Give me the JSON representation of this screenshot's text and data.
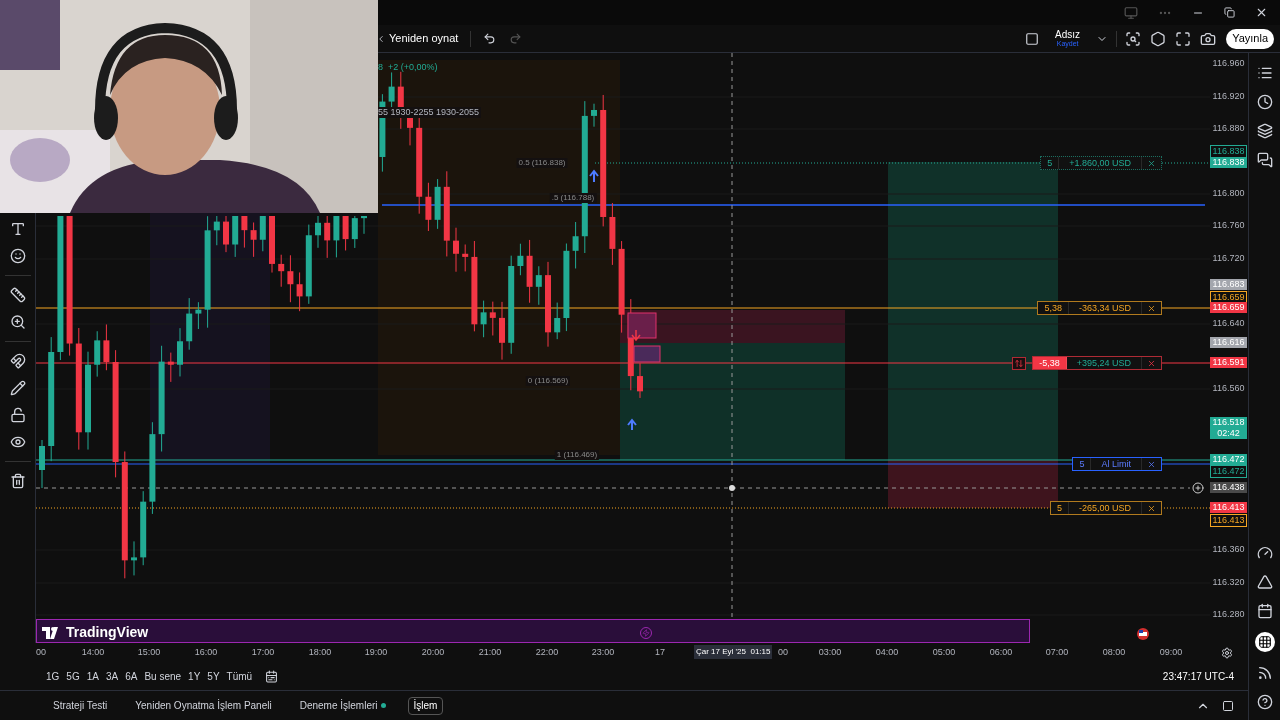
{
  "toolbar": {
    "replay_label": "Yeniden oynat",
    "layout_name": "Adsız",
    "save_label": "Kaydet",
    "publish_button": "Yayınla"
  },
  "chart": {
    "header_change": "8  +2 (+0,00%)",
    "session_label": "55 1930-2255 1930-2055",
    "fib_labels": [
      "0.5 (116.838)",
      ".5 (116.788)",
      "0 (116.569)",
      "1 (116.469)"
    ],
    "logo_text": "TradingView",
    "orders": [
      {
        "kind": "profit",
        "qty": "5",
        "pnl": "+1.860,00 USD",
        "reversible": false
      },
      {
        "kind": "stop",
        "qty": "5,38",
        "pnl": "-363,34 USD",
        "reversible": false
      },
      {
        "kind": "position",
        "qty": "-5,38",
        "pnl": "+395,24 USD",
        "reversible": true
      },
      {
        "kind": "limit",
        "qty": "5",
        "pnl": "Al Limit",
        "reversible": false
      },
      {
        "kind": "stop",
        "qty": "5",
        "pnl": "-265,00 USD",
        "reversible": false
      }
    ]
  },
  "price_axis": [
    {
      "label": "116.960",
      "kind": "plain"
    },
    {
      "label": "116.920",
      "kind": "plain"
    },
    {
      "label": "116.880",
      "kind": "plain"
    },
    {
      "label": "116.838",
      "kind": "green_outline"
    },
    {
      "label": "116.838",
      "kind": "green"
    },
    {
      "label": "116.800",
      "kind": "plain"
    },
    {
      "label": "116.760",
      "kind": "plain"
    },
    {
      "label": "116.720",
      "kind": "plain"
    },
    {
      "label": "116.683",
      "kind": "grey"
    },
    {
      "label": "116.659",
      "kind": "orange_outline"
    },
    {
      "label": "116.659",
      "kind": "red"
    },
    {
      "label": "116.640",
      "kind": "plain"
    },
    {
      "label": "116.616",
      "kind": "grey"
    },
    {
      "label": "116.591",
      "kind": "red"
    },
    {
      "label": "116.560",
      "kind": "plain"
    },
    {
      "label": "116.518",
      "kind": "green",
      "sub": "02:42"
    },
    {
      "label": "116.472",
      "kind": "green"
    },
    {
      "label": "116.472",
      "kind": "green_outline"
    },
    {
      "label": "116.438",
      "kind": "crosshair"
    },
    {
      "label": "116.413",
      "kind": "red"
    },
    {
      "label": "116.413",
      "kind": "orange_outline"
    },
    {
      "label": "116.360",
      "kind": "plain"
    },
    {
      "label": "116.320",
      "kind": "plain"
    },
    {
      "label": "116.280",
      "kind": "plain"
    }
  ],
  "time_axis": [
    "00",
    "14:00",
    "15:00",
    "16:00",
    "17:00",
    "18:00",
    "19:00",
    "20:00",
    "21:00",
    "22:00",
    "23:00",
    "17",
    "00",
    "03:00",
    "04:00",
    "05:00",
    "06:00",
    "07:00",
    "08:00",
    "09:00"
  ],
  "crosshair_time": "Çar 17 Eyl '25  01:15",
  "ranges": [
    "1G",
    "5G",
    "1A",
    "3A",
    "6A",
    "Bu sene",
    "1Y",
    "5Y",
    "Tümü"
  ],
  "clock": "23:47:17 UTC-4",
  "bottom_tabs": [
    {
      "label": "Strateji Testi",
      "selected": false,
      "has_dot": false
    },
    {
      "label": "Yeniden Oynatma İşlem Paneli",
      "selected": false,
      "has_dot": false
    },
    {
      "label": "Deneme İşlemleri",
      "selected": false,
      "has_dot": true
    },
    {
      "label": "İşlem",
      "selected": true,
      "has_dot": false
    }
  ]
}
